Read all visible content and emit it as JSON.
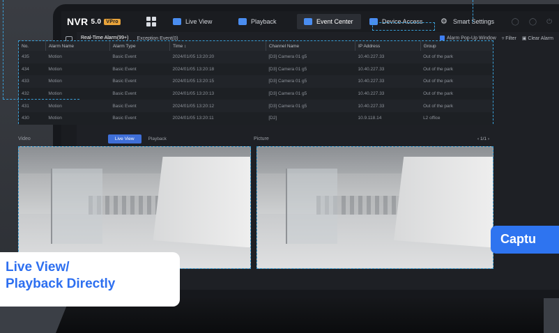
{
  "app": {
    "brand": "NVR",
    "version": "5.0",
    "badge": "VPro"
  },
  "nav": {
    "tabs": [
      {
        "label": "Live View"
      },
      {
        "label": "Playback"
      },
      {
        "label": "Event Center"
      },
      {
        "label": "Device Access"
      },
      {
        "label": "Smart Settings"
      }
    ]
  },
  "subtabs": {
    "realtime": "Real-Time Alarm(99+)",
    "exception": "Exception Event(0)",
    "popup": "Alarm Pop-Up Window",
    "filter": "Filter",
    "clear": "Clear Alarm"
  },
  "table": {
    "columns": [
      "No.",
      "Alarm Name",
      "Alarm Type",
      "Time ↕",
      "Channel Name",
      "IP Address",
      "Group"
    ],
    "rows": [
      [
        "435",
        "Motion",
        "Basic Event",
        "2024/01/05 13:20:20",
        "[D3] Camera 01 g5",
        "10.40.227.33",
        "Out of the park"
      ],
      [
        "434",
        "Motion",
        "Basic Event",
        "2024/01/05 13:20:18",
        "[D3] Camera 01 g5",
        "10.40.227.33",
        "Out of the park"
      ],
      [
        "433",
        "Motion",
        "Basic Event",
        "2024/01/05 13:20:15",
        "[D3] Camera 01 g5",
        "10.40.227.33",
        "Out of the park"
      ],
      [
        "432",
        "Motion",
        "Basic Event",
        "2024/01/05 13:20:13",
        "[D3] Camera 01 g5",
        "10.40.227.33",
        "Out of the park"
      ],
      [
        "431",
        "Motion",
        "Basic Event",
        "2024/01/05 13:20:12",
        "[D3] Camera 01 g5",
        "10.40.227.33",
        "Out of the park"
      ],
      [
        "430",
        "Motion",
        "Basic Event",
        "2024/01/05 13:20:11",
        "[D2]",
        "10.9.118.14",
        "L2 office"
      ]
    ]
  },
  "video": {
    "title": "Video",
    "live_view": "Live View",
    "playback": "Playback"
  },
  "picture": {
    "title": "Picture",
    "pager": "1/1"
  },
  "callouts": {
    "left_line1": "Live View/",
    "left_line2": "Playback Directly",
    "right": "Captu"
  },
  "colors": {
    "accent": "#2e74f0",
    "highlight": "#3aa0d8",
    "badge": "#e8a33a"
  }
}
